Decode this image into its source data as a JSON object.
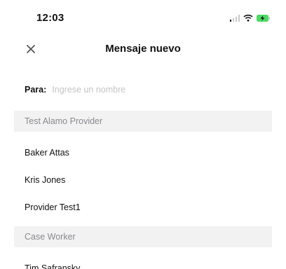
{
  "status_bar": {
    "time": "12:03",
    "icons": [
      "signal-icon",
      "wifi-icon",
      "battery-charging-icon"
    ]
  },
  "nav": {
    "title": "Mensaje nuevo",
    "close_icon": "close-icon"
  },
  "recipient": {
    "label": "Para:",
    "placeholder": "Ingrese un nombre",
    "value": ""
  },
  "sections": [
    {
      "title": "Test Alamo Provider",
      "contacts": [
        "Baker Attas",
        "Kris Jones",
        "Provider Test1"
      ]
    },
    {
      "title": "Case Worker",
      "contacts": [
        "Tim Safransky"
      ]
    }
  ],
  "colors": {
    "section_bg": "#f2f2f3",
    "section_text": "#8a8a8e",
    "placeholder": "#c4c4c4",
    "battery_charging": "#4cd964"
  }
}
